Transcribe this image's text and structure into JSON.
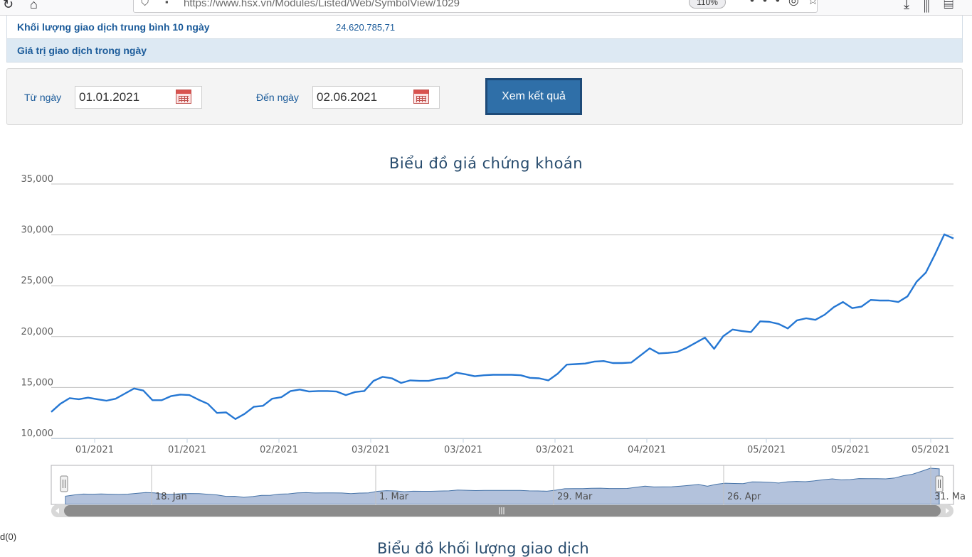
{
  "browser": {
    "url": "https://www.hsx.vn/Modules/Listed/Web/SymbolView/1029",
    "zoom": "110%"
  },
  "info": {
    "rows": [
      {
        "label": "Khối lượng giao dịch trung bình 10 ngày",
        "value": "24.620.785,71"
      },
      {
        "label": "Giá trị giao dịch trong ngày",
        "value": ""
      }
    ]
  },
  "filter": {
    "from_label": "Từ ngày",
    "from_value": "01.01.2021",
    "to_label": "Đến ngày",
    "to_value": "02.06.2021",
    "submit_label": "Xem kết quả"
  },
  "colors": {
    "line": "#2577d3",
    "grid": "#c0c0c0",
    "navigator_fill": "#a6b7d6",
    "scrollbar": "#8c8c8c"
  },
  "chart_data": {
    "type": "line",
    "title": "Biểu đồ giá chứng khoán",
    "ylim": [
      10000,
      35000
    ],
    "y_ticks": [
      "10,000",
      "15,000",
      "20,000",
      "25,000",
      "30,000",
      "35,000"
    ],
    "x_tick_labels": [
      "01/2021",
      "01/2021",
      "02/2021",
      "03/2021",
      "03/2021",
      "03/2021",
      "04/2021",
      "05/2021",
      "05/2021",
      "05/2021"
    ],
    "grid": true,
    "series": [
      {
        "values": [
          12600,
          13400,
          13950,
          13850,
          14000,
          13850,
          13700,
          13900,
          14400,
          14900,
          14700,
          13750,
          13750,
          14150,
          14300,
          14250,
          13800,
          13400,
          12500,
          12550,
          11900,
          12400,
          13100,
          13200,
          13900,
          14050,
          14650,
          14800,
          14600,
          14650,
          14650,
          14600,
          14250,
          14550,
          14650,
          15650,
          16050,
          15900,
          15450,
          15700,
          15650,
          15650,
          15850,
          15950,
          16450,
          16300,
          16100,
          16200,
          16250,
          16250,
          16250,
          16200,
          15950,
          15900,
          15700,
          16350,
          17250,
          17300,
          17350,
          17550,
          17600,
          17400,
          17400,
          17450,
          18150,
          18850,
          18350,
          18400,
          18500,
          18900,
          19400,
          19900,
          18800,
          20050,
          20700,
          20550,
          20450,
          21500,
          21450,
          21250,
          20800,
          21600,
          21800,
          21650,
          22150,
          22900,
          23400,
          22800,
          22950,
          23600,
          23550,
          23550,
          23400,
          23950,
          25400,
          26300,
          28100,
          30050,
          29650
        ]
      }
    ],
    "navigator_labels": [
      "18. Jan",
      "1. Mar",
      "29. Mar",
      "26. Apr",
      "31. Ma"
    ]
  },
  "footer": {
    "left_text": "d(0)",
    "next_title": "Biểu đồ khối lượng giao dịch"
  }
}
